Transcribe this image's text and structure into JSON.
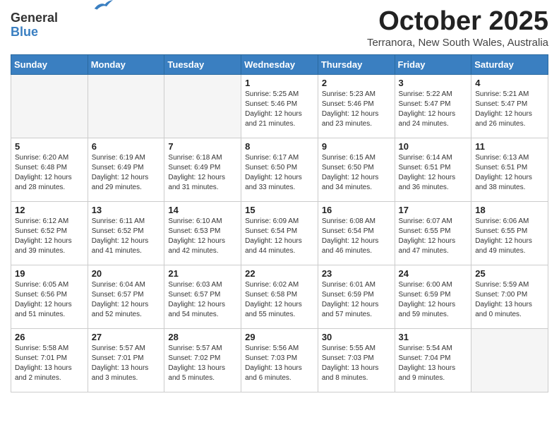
{
  "logo": {
    "general": "General",
    "blue": "Blue"
  },
  "title": "October 2025",
  "subtitle": "Terranora, New South Wales, Australia",
  "days_of_week": [
    "Sunday",
    "Monday",
    "Tuesday",
    "Wednesday",
    "Thursday",
    "Friday",
    "Saturday"
  ],
  "weeks": [
    [
      {
        "day": "",
        "info": "",
        "empty": true
      },
      {
        "day": "",
        "info": "",
        "empty": true
      },
      {
        "day": "",
        "info": "",
        "empty": true
      },
      {
        "day": "1",
        "info": "Sunrise: 5:25 AM\nSunset: 5:46 PM\nDaylight: 12 hours\nand 21 minutes."
      },
      {
        "day": "2",
        "info": "Sunrise: 5:23 AM\nSunset: 5:46 PM\nDaylight: 12 hours\nand 23 minutes."
      },
      {
        "day": "3",
        "info": "Sunrise: 5:22 AM\nSunset: 5:47 PM\nDaylight: 12 hours\nand 24 minutes."
      },
      {
        "day": "4",
        "info": "Sunrise: 5:21 AM\nSunset: 5:47 PM\nDaylight: 12 hours\nand 26 minutes."
      }
    ],
    [
      {
        "day": "5",
        "info": "Sunrise: 6:20 AM\nSunset: 6:48 PM\nDaylight: 12 hours\nand 28 minutes."
      },
      {
        "day": "6",
        "info": "Sunrise: 6:19 AM\nSunset: 6:49 PM\nDaylight: 12 hours\nand 29 minutes."
      },
      {
        "day": "7",
        "info": "Sunrise: 6:18 AM\nSunset: 6:49 PM\nDaylight: 12 hours\nand 31 minutes."
      },
      {
        "day": "8",
        "info": "Sunrise: 6:17 AM\nSunset: 6:50 PM\nDaylight: 12 hours\nand 33 minutes."
      },
      {
        "day": "9",
        "info": "Sunrise: 6:15 AM\nSunset: 6:50 PM\nDaylight: 12 hours\nand 34 minutes."
      },
      {
        "day": "10",
        "info": "Sunrise: 6:14 AM\nSunset: 6:51 PM\nDaylight: 12 hours\nand 36 minutes."
      },
      {
        "day": "11",
        "info": "Sunrise: 6:13 AM\nSunset: 6:51 PM\nDaylight: 12 hours\nand 38 minutes."
      }
    ],
    [
      {
        "day": "12",
        "info": "Sunrise: 6:12 AM\nSunset: 6:52 PM\nDaylight: 12 hours\nand 39 minutes."
      },
      {
        "day": "13",
        "info": "Sunrise: 6:11 AM\nSunset: 6:52 PM\nDaylight: 12 hours\nand 41 minutes."
      },
      {
        "day": "14",
        "info": "Sunrise: 6:10 AM\nSunset: 6:53 PM\nDaylight: 12 hours\nand 42 minutes."
      },
      {
        "day": "15",
        "info": "Sunrise: 6:09 AM\nSunset: 6:54 PM\nDaylight: 12 hours\nand 44 minutes."
      },
      {
        "day": "16",
        "info": "Sunrise: 6:08 AM\nSunset: 6:54 PM\nDaylight: 12 hours\nand 46 minutes."
      },
      {
        "day": "17",
        "info": "Sunrise: 6:07 AM\nSunset: 6:55 PM\nDaylight: 12 hours\nand 47 minutes."
      },
      {
        "day": "18",
        "info": "Sunrise: 6:06 AM\nSunset: 6:55 PM\nDaylight: 12 hours\nand 49 minutes."
      }
    ],
    [
      {
        "day": "19",
        "info": "Sunrise: 6:05 AM\nSunset: 6:56 PM\nDaylight: 12 hours\nand 51 minutes."
      },
      {
        "day": "20",
        "info": "Sunrise: 6:04 AM\nSunset: 6:57 PM\nDaylight: 12 hours\nand 52 minutes."
      },
      {
        "day": "21",
        "info": "Sunrise: 6:03 AM\nSunset: 6:57 PM\nDaylight: 12 hours\nand 54 minutes."
      },
      {
        "day": "22",
        "info": "Sunrise: 6:02 AM\nSunset: 6:58 PM\nDaylight: 12 hours\nand 55 minutes."
      },
      {
        "day": "23",
        "info": "Sunrise: 6:01 AM\nSunset: 6:59 PM\nDaylight: 12 hours\nand 57 minutes."
      },
      {
        "day": "24",
        "info": "Sunrise: 6:00 AM\nSunset: 6:59 PM\nDaylight: 12 hours\nand 59 minutes."
      },
      {
        "day": "25",
        "info": "Sunrise: 5:59 AM\nSunset: 7:00 PM\nDaylight: 13 hours\nand 0 minutes."
      }
    ],
    [
      {
        "day": "26",
        "info": "Sunrise: 5:58 AM\nSunset: 7:01 PM\nDaylight: 13 hours\nand 2 minutes."
      },
      {
        "day": "27",
        "info": "Sunrise: 5:57 AM\nSunset: 7:01 PM\nDaylight: 13 hours\nand 3 minutes."
      },
      {
        "day": "28",
        "info": "Sunrise: 5:57 AM\nSunset: 7:02 PM\nDaylight: 13 hours\nand 5 minutes."
      },
      {
        "day": "29",
        "info": "Sunrise: 5:56 AM\nSunset: 7:03 PM\nDaylight: 13 hours\nand 6 minutes."
      },
      {
        "day": "30",
        "info": "Sunrise: 5:55 AM\nSunset: 7:03 PM\nDaylight: 13 hours\nand 8 minutes."
      },
      {
        "day": "31",
        "info": "Sunrise: 5:54 AM\nSunset: 7:04 PM\nDaylight: 13 hours\nand 9 minutes."
      },
      {
        "day": "",
        "info": "",
        "empty": true
      }
    ]
  ]
}
